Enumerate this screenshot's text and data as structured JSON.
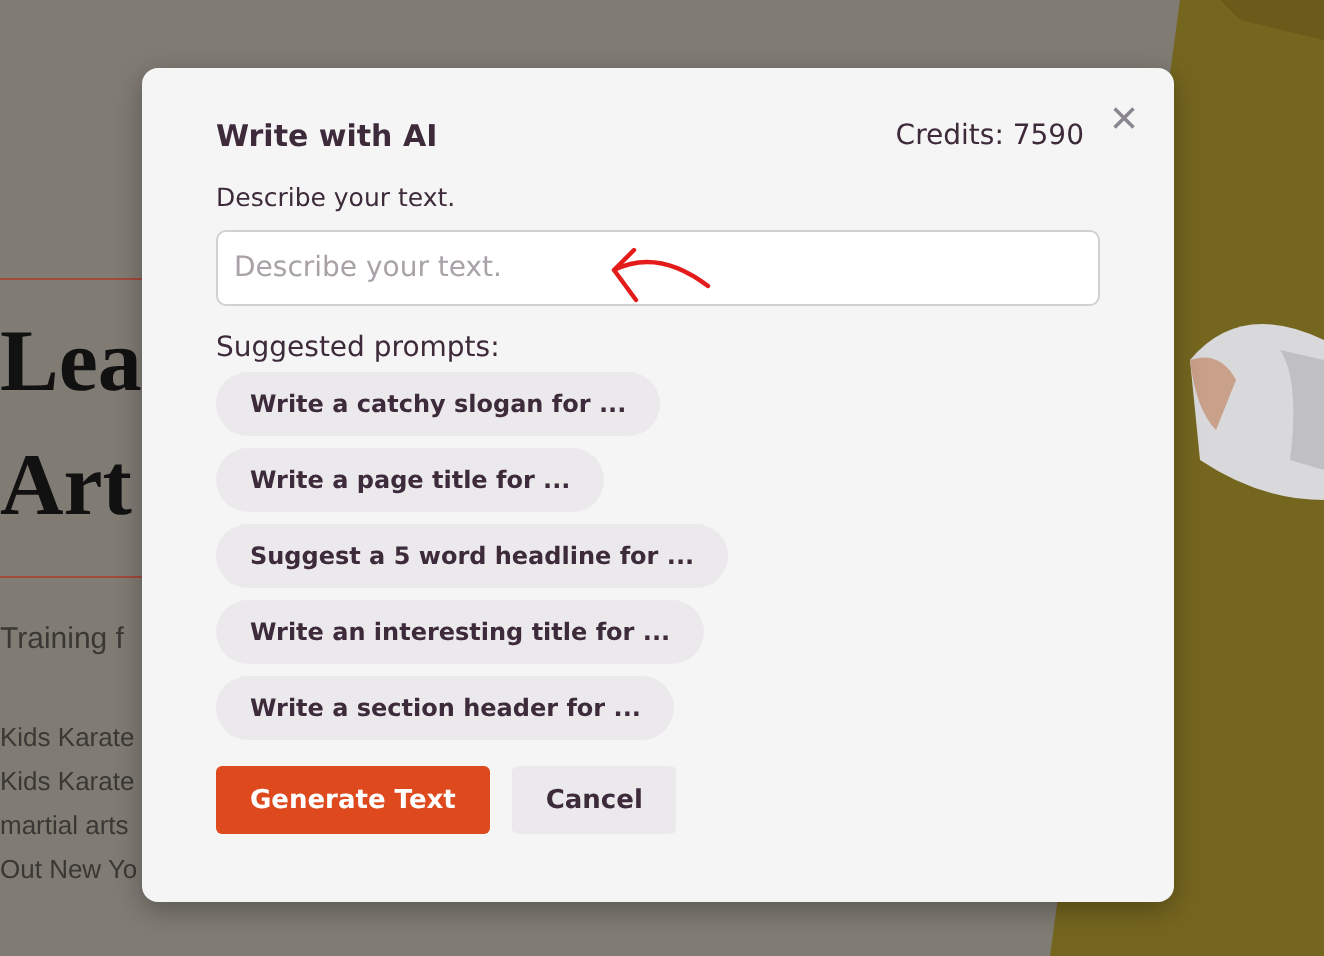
{
  "background_page": {
    "heading_lines": [
      "Lea",
      "Art"
    ],
    "subtitle": "Training f",
    "body_lines": [
      "Kids Karate",
      "Kids Karate",
      "martial arts",
      "Out New Yo"
    ],
    "hero": {
      "kind": "picture"
    }
  },
  "dialog": {
    "title": "Write with AI",
    "credits": "Credits: 7590",
    "close": "×",
    "field_label": "Describe your text.",
    "input": {
      "placeholder": "Describe your text."
    },
    "suggested_label": "Suggested prompts:",
    "prompts": [
      "Write a catchy slogan for ...",
      "Write a page title for ...",
      "Suggest a 5 word headline for ...",
      "Write an interesting title for ...",
      "Write a section header for ..."
    ],
    "buttons": [
      {
        "label": "Generate Text",
        "kind": "primary"
      },
      {
        "label": "Cancel",
        "kind": "secondary"
      }
    ]
  }
}
